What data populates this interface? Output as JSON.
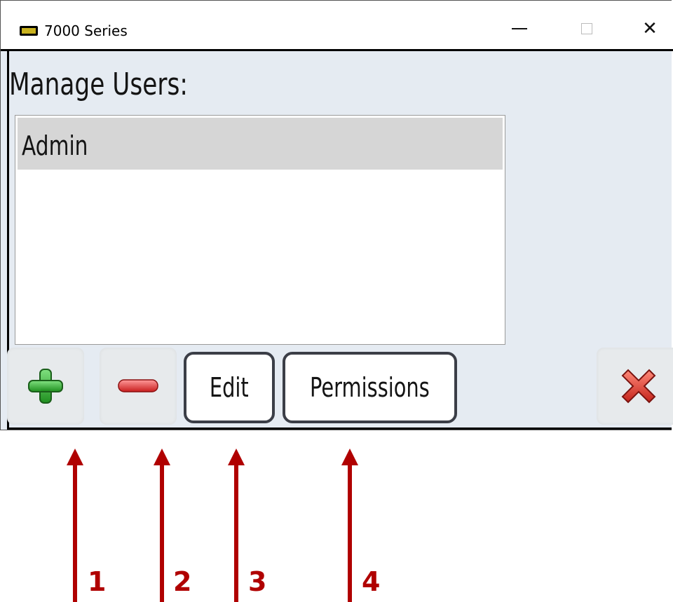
{
  "window": {
    "title": "7000 Series"
  },
  "main": {
    "heading": "Manage Users:",
    "users": [
      "Admin"
    ]
  },
  "toolbar": {
    "add_icon": "plus-icon",
    "remove_icon": "minus-icon",
    "edit_label": "Edit",
    "permissions_label": "Permissions",
    "close_icon": "red-x-icon"
  },
  "annotations": {
    "labels": [
      "1",
      "2",
      "3",
      "4"
    ],
    "color": "#b00000"
  },
  "colors": {
    "background": "#e5ebf2",
    "selected_row": "#d6d6d6",
    "add_green": "#2ca72c",
    "remove_red": "#e23a3a",
    "close_red": "#e0382f"
  }
}
